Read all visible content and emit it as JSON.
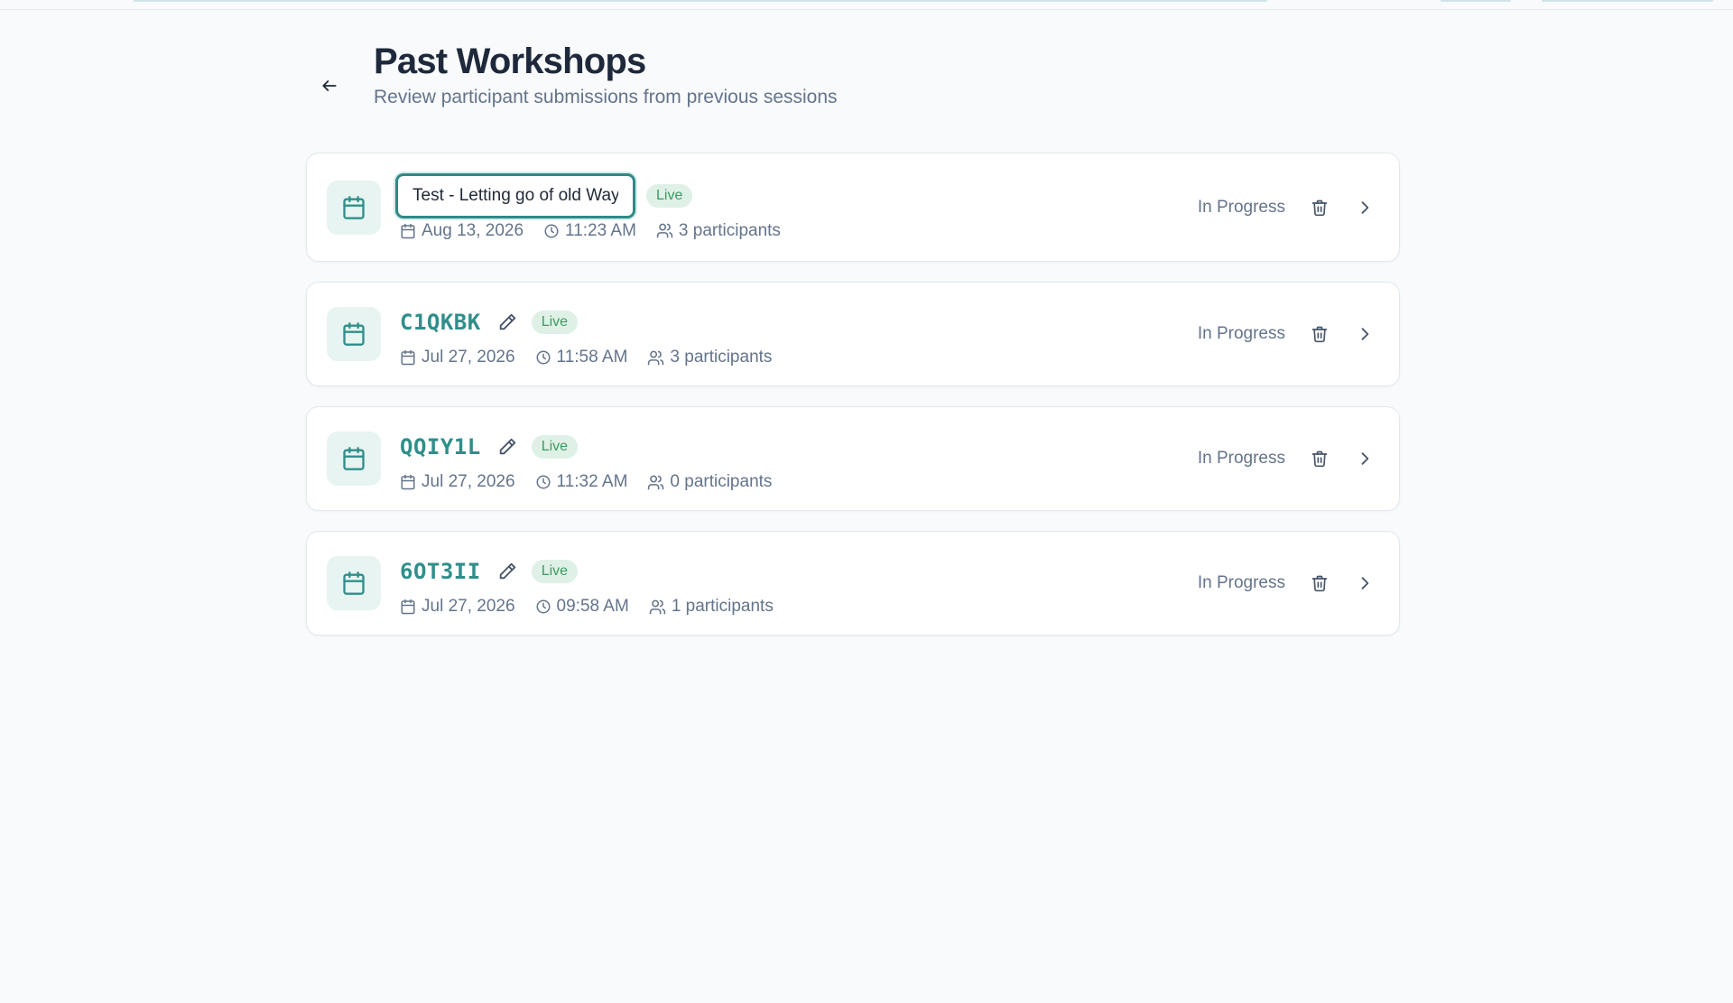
{
  "header": {
    "title": "Past Workshops",
    "subtitle": "Review participant submissions from previous sessions"
  },
  "colors": {
    "accent": "#2f8f8a",
    "badge_bg": "#dff1e6",
    "badge_text": "#3e9a62",
    "icon_tile": "#e7f4f1"
  },
  "icons": {
    "back": "arrow-left-icon",
    "workshop": "calendar-icon",
    "date": "calendar-small-icon",
    "time": "clock-icon",
    "participants": "users-icon",
    "edit": "pencil-icon",
    "delete": "trash-icon",
    "open": "chevron-right-icon"
  },
  "workshops": [
    {
      "name_input_value": "Test - Letting go of old Ways",
      "badge": "Live",
      "date": "Aug 13, 2026",
      "time": "11:23 AM",
      "participants": "3 participants",
      "status": "In Progress"
    },
    {
      "code": "C1QKBK",
      "badge": "Live",
      "date": "Jul 27, 2026",
      "time": "11:58 AM",
      "participants": "3 participants",
      "status": "In Progress"
    },
    {
      "code": "QQIY1L",
      "badge": "Live",
      "date": "Jul 27, 2026",
      "time": "11:32 AM",
      "participants": "0 participants",
      "status": "In Progress"
    },
    {
      "code": "6OT3II",
      "badge": "Live",
      "date": "Jul 27, 2026",
      "time": "09:58 AM",
      "participants": "1 participants",
      "status": "In Progress"
    }
  ]
}
